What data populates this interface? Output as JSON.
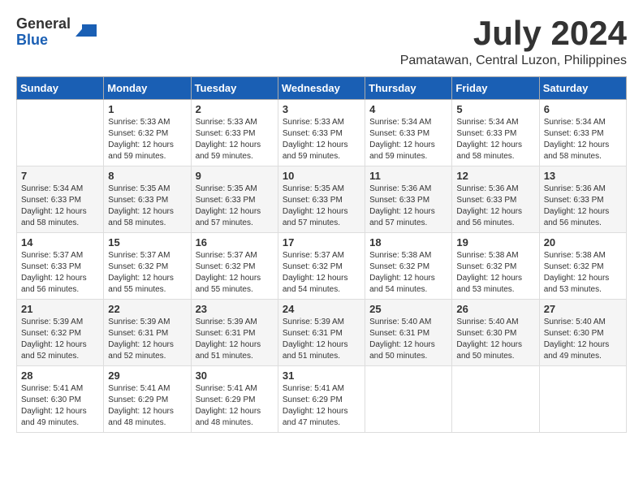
{
  "logo": {
    "general": "General",
    "blue": "Blue"
  },
  "title": "July 2024",
  "location": "Pamatawan, Central Luzon, Philippines",
  "weekdays": [
    "Sunday",
    "Monday",
    "Tuesday",
    "Wednesday",
    "Thursday",
    "Friday",
    "Saturday"
  ],
  "weeks": [
    [
      {
        "day": "",
        "info": ""
      },
      {
        "day": "1",
        "info": "Sunrise: 5:33 AM\nSunset: 6:32 PM\nDaylight: 12 hours\nand 59 minutes."
      },
      {
        "day": "2",
        "info": "Sunrise: 5:33 AM\nSunset: 6:33 PM\nDaylight: 12 hours\nand 59 minutes."
      },
      {
        "day": "3",
        "info": "Sunrise: 5:33 AM\nSunset: 6:33 PM\nDaylight: 12 hours\nand 59 minutes."
      },
      {
        "day": "4",
        "info": "Sunrise: 5:34 AM\nSunset: 6:33 PM\nDaylight: 12 hours\nand 59 minutes."
      },
      {
        "day": "5",
        "info": "Sunrise: 5:34 AM\nSunset: 6:33 PM\nDaylight: 12 hours\nand 58 minutes."
      },
      {
        "day": "6",
        "info": "Sunrise: 5:34 AM\nSunset: 6:33 PM\nDaylight: 12 hours\nand 58 minutes."
      }
    ],
    [
      {
        "day": "7",
        "info": "Sunrise: 5:34 AM\nSunset: 6:33 PM\nDaylight: 12 hours\nand 58 minutes."
      },
      {
        "day": "8",
        "info": "Sunrise: 5:35 AM\nSunset: 6:33 PM\nDaylight: 12 hours\nand 58 minutes."
      },
      {
        "day": "9",
        "info": "Sunrise: 5:35 AM\nSunset: 6:33 PM\nDaylight: 12 hours\nand 57 minutes."
      },
      {
        "day": "10",
        "info": "Sunrise: 5:35 AM\nSunset: 6:33 PM\nDaylight: 12 hours\nand 57 minutes."
      },
      {
        "day": "11",
        "info": "Sunrise: 5:36 AM\nSunset: 6:33 PM\nDaylight: 12 hours\nand 57 minutes."
      },
      {
        "day": "12",
        "info": "Sunrise: 5:36 AM\nSunset: 6:33 PM\nDaylight: 12 hours\nand 56 minutes."
      },
      {
        "day": "13",
        "info": "Sunrise: 5:36 AM\nSunset: 6:33 PM\nDaylight: 12 hours\nand 56 minutes."
      }
    ],
    [
      {
        "day": "14",
        "info": "Sunrise: 5:37 AM\nSunset: 6:33 PM\nDaylight: 12 hours\nand 56 minutes."
      },
      {
        "day": "15",
        "info": "Sunrise: 5:37 AM\nSunset: 6:32 PM\nDaylight: 12 hours\nand 55 minutes."
      },
      {
        "day": "16",
        "info": "Sunrise: 5:37 AM\nSunset: 6:32 PM\nDaylight: 12 hours\nand 55 minutes."
      },
      {
        "day": "17",
        "info": "Sunrise: 5:37 AM\nSunset: 6:32 PM\nDaylight: 12 hours\nand 54 minutes."
      },
      {
        "day": "18",
        "info": "Sunrise: 5:38 AM\nSunset: 6:32 PM\nDaylight: 12 hours\nand 54 minutes."
      },
      {
        "day": "19",
        "info": "Sunrise: 5:38 AM\nSunset: 6:32 PM\nDaylight: 12 hours\nand 53 minutes."
      },
      {
        "day": "20",
        "info": "Sunrise: 5:38 AM\nSunset: 6:32 PM\nDaylight: 12 hours\nand 53 minutes."
      }
    ],
    [
      {
        "day": "21",
        "info": "Sunrise: 5:39 AM\nSunset: 6:32 PM\nDaylight: 12 hours\nand 52 minutes."
      },
      {
        "day": "22",
        "info": "Sunrise: 5:39 AM\nSunset: 6:31 PM\nDaylight: 12 hours\nand 52 minutes."
      },
      {
        "day": "23",
        "info": "Sunrise: 5:39 AM\nSunset: 6:31 PM\nDaylight: 12 hours\nand 51 minutes."
      },
      {
        "day": "24",
        "info": "Sunrise: 5:39 AM\nSunset: 6:31 PM\nDaylight: 12 hours\nand 51 minutes."
      },
      {
        "day": "25",
        "info": "Sunrise: 5:40 AM\nSunset: 6:31 PM\nDaylight: 12 hours\nand 50 minutes."
      },
      {
        "day": "26",
        "info": "Sunrise: 5:40 AM\nSunset: 6:30 PM\nDaylight: 12 hours\nand 50 minutes."
      },
      {
        "day": "27",
        "info": "Sunrise: 5:40 AM\nSunset: 6:30 PM\nDaylight: 12 hours\nand 49 minutes."
      }
    ],
    [
      {
        "day": "28",
        "info": "Sunrise: 5:41 AM\nSunset: 6:30 PM\nDaylight: 12 hours\nand 49 minutes."
      },
      {
        "day": "29",
        "info": "Sunrise: 5:41 AM\nSunset: 6:29 PM\nDaylight: 12 hours\nand 48 minutes."
      },
      {
        "day": "30",
        "info": "Sunrise: 5:41 AM\nSunset: 6:29 PM\nDaylight: 12 hours\nand 48 minutes."
      },
      {
        "day": "31",
        "info": "Sunrise: 5:41 AM\nSunset: 6:29 PM\nDaylight: 12 hours\nand 47 minutes."
      },
      {
        "day": "",
        "info": ""
      },
      {
        "day": "",
        "info": ""
      },
      {
        "day": "",
        "info": ""
      }
    ]
  ]
}
